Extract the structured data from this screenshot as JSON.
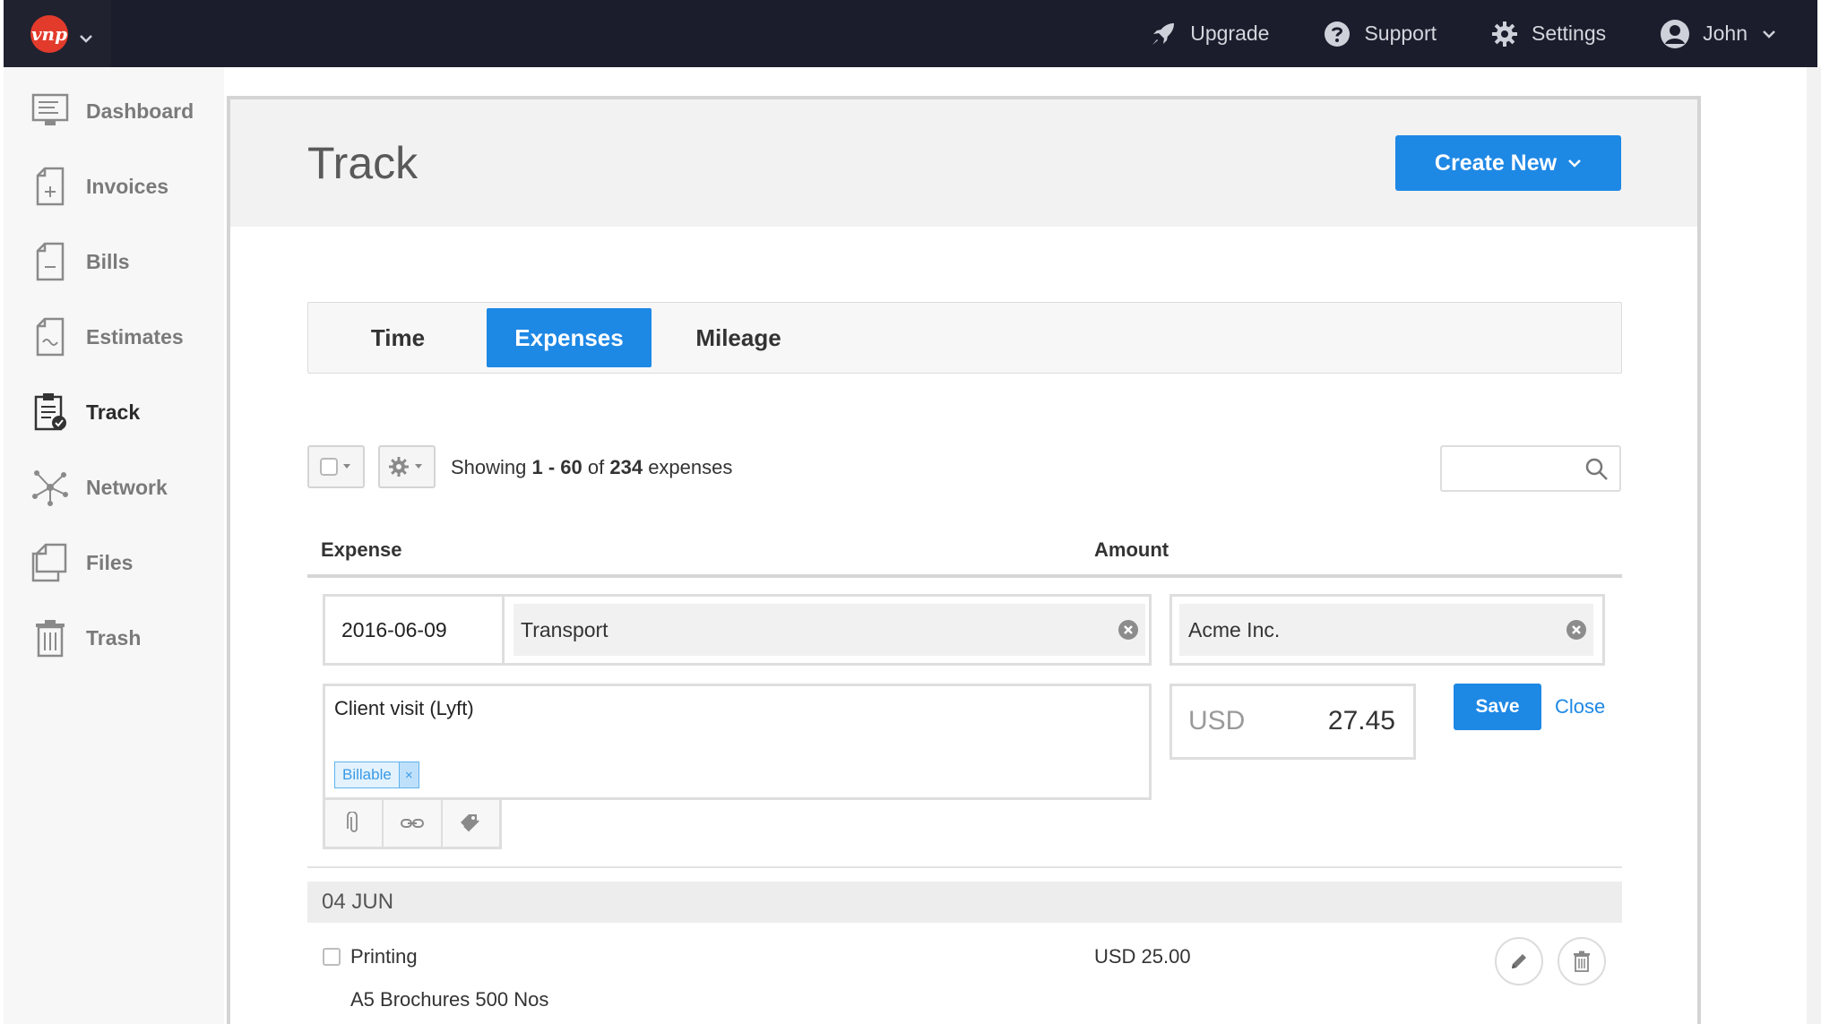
{
  "app": {
    "logo_text": "vnp"
  },
  "topnav": {
    "upgrade": "Upgrade",
    "support": "Support",
    "settings": "Settings",
    "user": "John"
  },
  "sidebar": {
    "items": [
      {
        "label": "Dashboard",
        "icon": "monitor-icon"
      },
      {
        "label": "Invoices",
        "icon": "invoice-plus-icon"
      },
      {
        "label": "Bills",
        "icon": "bill-minus-icon"
      },
      {
        "label": "Estimates",
        "icon": "estimate-wave-icon"
      },
      {
        "label": "Track",
        "icon": "clipboard-check-icon",
        "active": true
      },
      {
        "label": "Network",
        "icon": "network-icon"
      },
      {
        "label": "Files",
        "icon": "files-icon"
      },
      {
        "label": "Trash",
        "icon": "trash-icon"
      }
    ]
  },
  "page": {
    "title": "Track",
    "create_new": "Create New"
  },
  "tabs": [
    {
      "label": "Time",
      "active": false
    },
    {
      "label": "Expenses",
      "active": true
    },
    {
      "label": "Mileage",
      "active": false
    }
  ],
  "list": {
    "showing_prefix": "Showing ",
    "range": "1 - 60",
    "of": " of ",
    "total": "234",
    "suffix": " expenses",
    "search_placeholder": ""
  },
  "columns": {
    "expense": "Expense",
    "amount": "Amount"
  },
  "editor": {
    "date": "2016-06-09",
    "category": "Transport",
    "client": "Acme Inc.",
    "notes": "Client visit (Lyft)",
    "tag": "Billable",
    "tag_remove": "×",
    "currency": "USD",
    "amount": "27.45",
    "save": "Save",
    "close": "Close"
  },
  "groups": [
    {
      "date": "04 JUN",
      "rows": [
        {
          "title": "Printing",
          "amount": "USD 25.00",
          "description": "A5 Brochures 500 Nos"
        }
      ]
    }
  ],
  "colors": {
    "accent": "#1e88e5",
    "topbar": "#1b1d2c",
    "logo": "#e23b2c"
  }
}
